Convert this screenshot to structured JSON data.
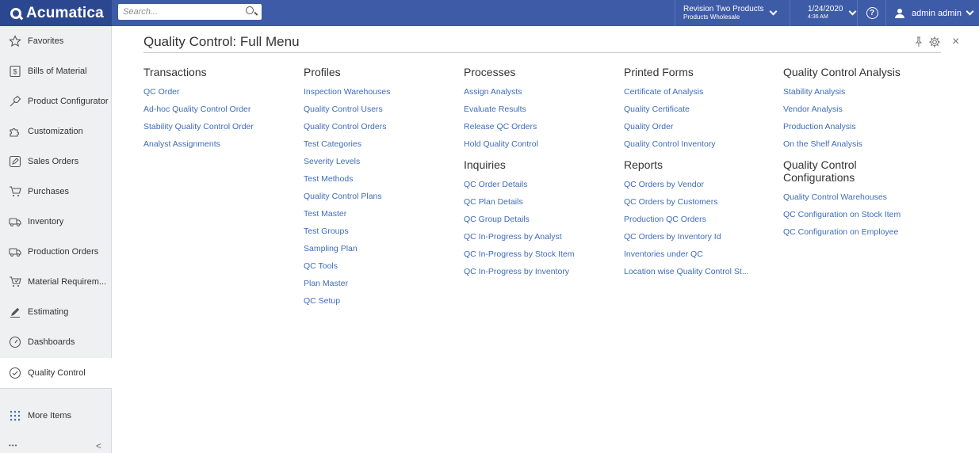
{
  "app": {
    "logo": "Acumatica",
    "search_placeholder": "Search...",
    "company_line1": "Revision Two Products",
    "company_line2": "Products Wholesale",
    "date": "1/24/2020",
    "time": "4:36 AM",
    "help": "?",
    "user": "admin admin"
  },
  "sidebar": {
    "items": [
      {
        "label": "Favorites",
        "icon": "star-icon"
      },
      {
        "label": "Bills of Material",
        "icon": "bill-icon"
      },
      {
        "label": "Product Configurator",
        "icon": "wrench-icon"
      },
      {
        "label": "Customization",
        "icon": "puzzle-icon"
      },
      {
        "label": "Sales Orders",
        "icon": "edit-icon"
      },
      {
        "label": "Purchases",
        "icon": "cart-icon"
      },
      {
        "label": "Inventory",
        "icon": "truck-icon"
      },
      {
        "label": "Production Orders",
        "icon": "truck-icon"
      },
      {
        "label": "Material Requirem...",
        "icon": "cart-check-icon"
      },
      {
        "label": "Estimating",
        "icon": "pencil-icon"
      },
      {
        "label": "Dashboards",
        "icon": "gauge-icon"
      },
      {
        "label": "Quality Control",
        "icon": "check-circle-icon"
      }
    ],
    "more_items": "More Items",
    "ellipsis": "•••",
    "collapse": "<"
  },
  "main": {
    "title": "Quality Control: Full Menu",
    "close": "×",
    "columns": [
      {
        "sections": [
          {
            "heading": "Transactions",
            "links": [
              "QC Order",
              "Ad-hoc Quality Control Order",
              "Stability Quality Control Order",
              "Analyst Assignments"
            ]
          }
        ]
      },
      {
        "sections": [
          {
            "heading": "Profiles",
            "links": [
              "Inspection Warehouses",
              "Quality Control Users",
              "Quality Control Orders",
              "Test Categories",
              "Severity Levels",
              "Test Methods",
              "Quality Control Plans",
              "Test Master",
              "Test Groups",
              "Sampling Plan",
              "QC Tools",
              "Plan Master",
              "QC Setup"
            ]
          }
        ]
      },
      {
        "sections": [
          {
            "heading": "Processes",
            "links": [
              "Assign Analysts",
              "Evaluate Results",
              "Release QC Orders",
              "Hold Quality Control"
            ]
          },
          {
            "heading": "Inquiries",
            "links": [
              "QC Order Details",
              "QC Plan Details",
              "QC Group Details",
              "QC In-Progress by Analyst",
              "QC In-Progress by Stock Item",
              "QC In-Progress by Inventory"
            ]
          }
        ]
      },
      {
        "sections": [
          {
            "heading": "Printed Forms",
            "links": [
              "Certificate of Analysis",
              "Quality Certificate",
              "Quality Order",
              "Quality Control Inventory"
            ]
          },
          {
            "heading": "Reports",
            "links": [
              "QC Orders by Vendor",
              "QC Orders by Customers",
              "Production QC Orders",
              "QC Orders by Inventory Id",
              "Inventories under QC",
              "Location wise Quality Control St..."
            ]
          }
        ]
      },
      {
        "sections": [
          {
            "heading": "Quality Control Analysis",
            "links": [
              "Stability Analysis",
              "Vendor Analysis",
              "Production Analysis",
              "On the Shelf Analysis"
            ]
          },
          {
            "heading": "Quality Control Configurations",
            "links": [
              "Quality Control Warehouses",
              "QC Configuration on Stock Item",
              "QC Configuration on Employee"
            ]
          }
        ]
      }
    ]
  }
}
